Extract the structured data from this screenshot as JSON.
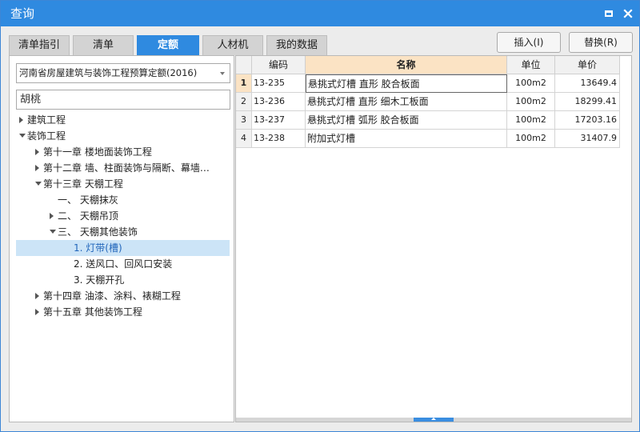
{
  "window": {
    "title": "查询"
  },
  "tabs": [
    {
      "label": "清单指引",
      "active": false
    },
    {
      "label": "清单",
      "active": false
    },
    {
      "label": "定额",
      "active": true
    },
    {
      "label": "人材机",
      "active": false
    },
    {
      "label": "我的数据",
      "active": false
    }
  ],
  "actions": {
    "insert_label": "插入(I)",
    "replace_label": "替换(R)"
  },
  "library": {
    "selected": "河南省房屋建筑与装饰工程预算定额(2016)"
  },
  "search": {
    "value": "胡桃"
  },
  "tree": [
    {
      "label": "建筑工程",
      "state": "collapsed"
    },
    {
      "label": "装饰工程",
      "state": "expanded"
    },
    {
      "label": "第十一章 楼地面装饰工程",
      "state": "collapsed"
    },
    {
      "label": "第十二章 墙、柱面装饰与隔断、幕墙…",
      "state": "collapsed"
    },
    {
      "label": "第十三章 天棚工程",
      "state": "expanded"
    },
    {
      "label": "一、 天棚抹灰",
      "state": "leaf"
    },
    {
      "label": "二、 天棚吊顶",
      "state": "collapsed"
    },
    {
      "label": "三、 天棚其他装饰",
      "state": "expanded"
    },
    {
      "label": "1. 灯带(槽)",
      "state": "leaf",
      "selected": true
    },
    {
      "label": "2. 送风口、回风口安装",
      "state": "leaf"
    },
    {
      "label": "3. 天棚开孔",
      "state": "leaf"
    },
    {
      "label": "第十四章 油漆、涂料、裱糊工程",
      "state": "collapsed"
    },
    {
      "label": "第十五章 其他装饰工程",
      "state": "collapsed"
    }
  ],
  "table": {
    "columns": [
      "编码",
      "名称",
      "单位",
      "单价"
    ],
    "rows": [
      {
        "no": "1",
        "code": "13-235",
        "name": "悬挑式灯槽 直形 胶合板面",
        "unit": "100m2",
        "price": "13649.4"
      },
      {
        "no": "2",
        "code": "13-236",
        "name": "悬挑式灯槽 直形 细木工板面",
        "unit": "100m2",
        "price": "18299.41"
      },
      {
        "no": "3",
        "code": "13-237",
        "name": "悬挑式灯槽 弧形 胶合板面",
        "unit": "100m2",
        "price": "17203.16"
      },
      {
        "no": "4",
        "code": "13-238",
        "name": "附加式灯槽",
        "unit": "100m2",
        "price": "31407.9"
      }
    ]
  },
  "icons": {
    "maximize": "maximize-icon",
    "close": "close-icon"
  },
  "colors": {
    "accent": "#2f8ae0",
    "selection": "#cce4f7",
    "header_highlight": "#fbe3c4"
  }
}
